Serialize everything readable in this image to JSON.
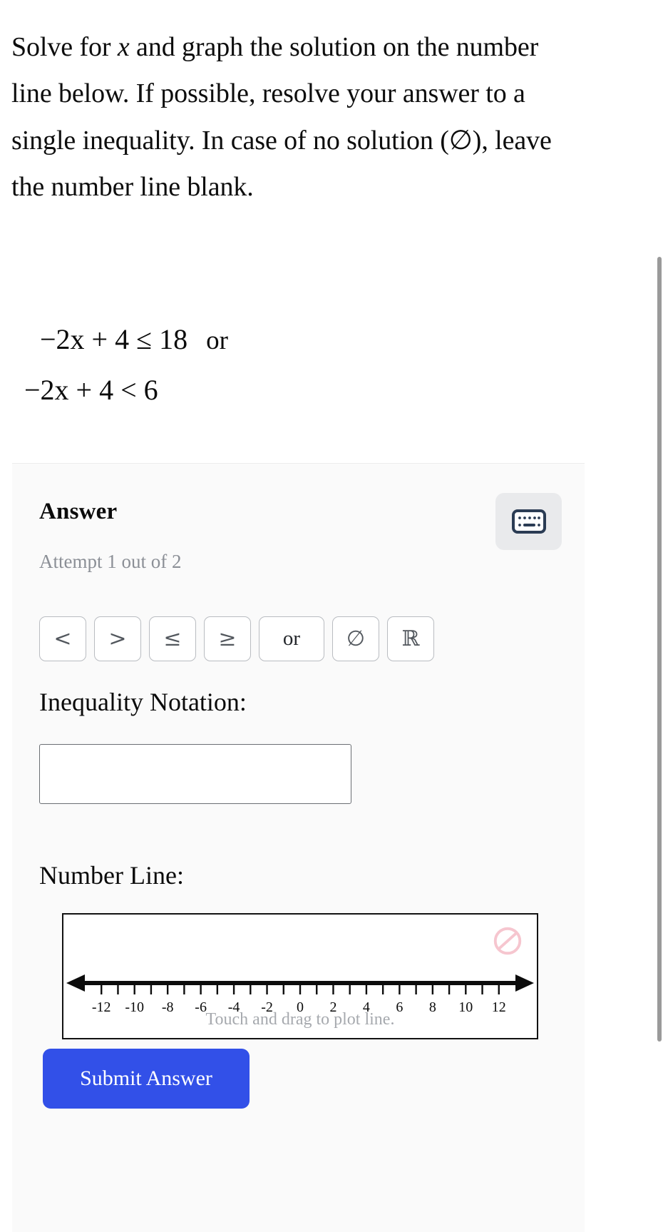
{
  "question": {
    "line1_a": "Solve for ",
    "variable": "x",
    "line1_b": " and graph the solution on the number line below. If possible, resolve your answer to a single inequality. In case of no solution (∅), leave the number line blank."
  },
  "math": {
    "line1": "−2x + 4 ≤ 18",
    "line1_connector": "or",
    "line2": "−2x + 4 < 6"
  },
  "answer": {
    "heading": "Answer",
    "keyboard_icon": "keyboard-icon",
    "attempt_text": "Attempt 1 out of 2",
    "operators": [
      {
        "name": "less-than",
        "label": "<",
        "wide": false
      },
      {
        "name": "greater-than",
        "label": ">",
        "wide": false
      },
      {
        "name": "less-than-or-equal",
        "label": "≤",
        "wide": false
      },
      {
        "name": "greater-than-or-equal",
        "label": "≥",
        "wide": false
      },
      {
        "name": "or-operator",
        "label": "or",
        "wide": true
      },
      {
        "name": "empty-set",
        "label": "∅",
        "wide": false
      },
      {
        "name": "real-numbers",
        "label": "ℝ",
        "wide": false
      }
    ],
    "inequality_label": "Inequality Notation:",
    "inequality_value": "",
    "inequality_placeholder": "",
    "numberline_label": "Number Line:",
    "submit_label": "Submit Answer"
  },
  "number_line": {
    "hint": "Touch and drag to plot line.",
    "no_entry_icon": "no-entry-icon",
    "no_entry_color": "#f6c6cf",
    "min": -13,
    "max": 13,
    "tick_step": 1,
    "labeled_ticks": [
      -12,
      -10,
      -8,
      -6,
      -4,
      -2,
      0,
      2,
      4,
      6,
      8,
      10,
      12
    ],
    "labels": [
      "-12",
      "-10",
      "-8",
      "-6",
      "-4",
      "-2",
      "0",
      "2",
      "4",
      "6",
      "8",
      "10",
      "12"
    ],
    "arrows": "both",
    "plotted": false
  },
  "colors": {
    "submit_blue": "#3250e8",
    "panel_bg": "#fafafa",
    "muted_text": "#8b8f96",
    "keyboard_icon_navy": "#2b3c54"
  }
}
